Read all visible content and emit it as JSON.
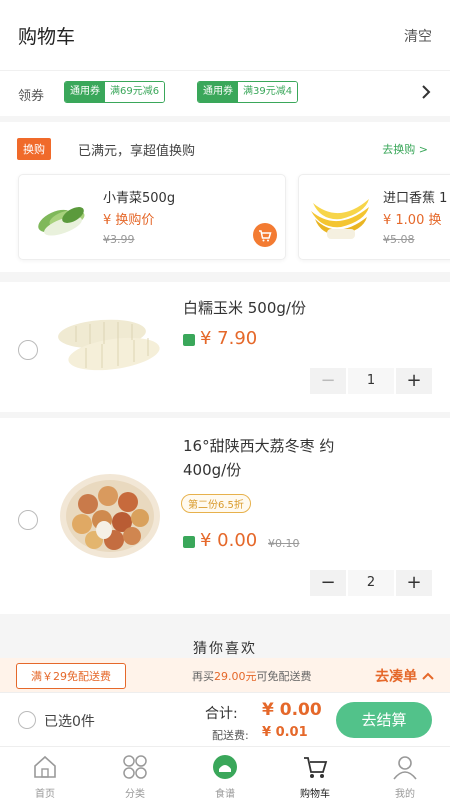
{
  "header": {
    "title": "购物车",
    "clear_label": "清空"
  },
  "coupons": {
    "label": "领券",
    "items": [
      {
        "type": "通用券",
        "value": "满69元减6"
      },
      {
        "type": "通用券",
        "value": "满39元减4"
      }
    ]
  },
  "swap": {
    "badge": "换购",
    "text": "已满元，享超值换购",
    "link": "去换购 >",
    "products": [
      {
        "name": "小青菜500g",
        "price": "¥ 换购价",
        "orig": "¥3.99"
      },
      {
        "name": "进口香蕉 1",
        "price": "¥ 1.00 换",
        "orig": "¥5.08"
      }
    ]
  },
  "cart": {
    "items": [
      {
        "name": "白糯玉米 500g/份",
        "price": "¥ 7.90",
        "orig": "",
        "promo": "",
        "qty": "1"
      },
      {
        "name_line1": "16°甜陕西大荔冬枣 约",
        "name_line2": "400g/份",
        "price": "¥ 0.00",
        "orig": "¥0.10",
        "promo": "第二份6.5折",
        "qty": "2"
      }
    ]
  },
  "guess": {
    "title": "猜你喜欢"
  },
  "delivery": {
    "tag": "满￥29免配送费",
    "text_prefix": "再买",
    "amount": "29.00元",
    "text_suffix": "可免配送费",
    "link": "去凑单"
  },
  "checkout": {
    "selected": "已选0件",
    "total_label": "合计:",
    "total": "¥ 0.00",
    "fee_label": "配送费:",
    "fee": "¥ 0.01",
    "button": "去结算"
  },
  "tabbar": [
    {
      "label": "首页",
      "icon": "home-icon"
    },
    {
      "label": "分类",
      "icon": "category-icon"
    },
    {
      "label": "食谱",
      "icon": "recipe-icon"
    },
    {
      "label": "购物车",
      "icon": "cart-icon",
      "active": true
    },
    {
      "label": "我的",
      "icon": "profile-icon"
    }
  ],
  "colors": {
    "accent_green": "#3aa75a",
    "price_orange": "#e5682a",
    "checkout_green": "#52c28a"
  }
}
